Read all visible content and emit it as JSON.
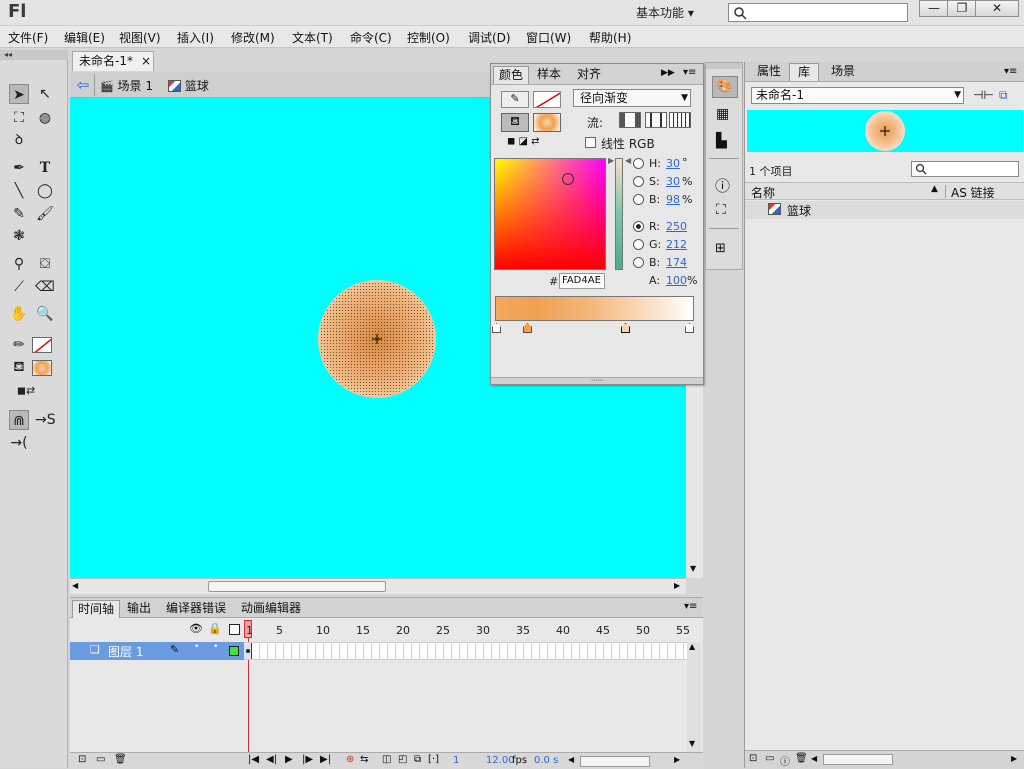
{
  "app": {
    "logo": "Fl",
    "workspace": "基本功能 ▾",
    "window_buttons": [
      "—",
      "❐",
      "✕"
    ]
  },
  "menu": [
    "文件(F)",
    "编辑(E)",
    "视图(V)",
    "插入(I)",
    "修改(M)",
    "文本(T)",
    "命令(C)",
    "控制(O)",
    "调试(D)",
    "窗口(W)",
    "帮助(H)"
  ],
  "document": {
    "tab_title": "未命名-1*",
    "tab_close": "×"
  },
  "editbar": {
    "scene": "场景 1",
    "symbol": "篮球"
  },
  "stage": {
    "background_color": "#00ffff"
  },
  "color_panel": {
    "tabs": [
      "颜色",
      "样本",
      "对齐"
    ],
    "fill_type": "径向渐变",
    "flow_label": "流:",
    "linear_rgb_label": "线性 RGB",
    "hsb": [
      {
        "label": "H:",
        "value": "30",
        "unit": "°"
      },
      {
        "label": "S:",
        "value": "30",
        "unit": "%"
      },
      {
        "label": "B:",
        "value": "98",
        "unit": "%"
      }
    ],
    "rgb": [
      {
        "label": "R:",
        "value": "250"
      },
      {
        "label": "G:",
        "value": "212"
      },
      {
        "label": "B:",
        "value": "174"
      }
    ],
    "hex_label": "#",
    "hex": "FAD4AE",
    "alpha_label": "A:",
    "alpha": "100",
    "alpha_unit": "%"
  },
  "properties_panel": {
    "tabs": [
      "属性",
      "库",
      "场景"
    ],
    "library_name": "未命名-1",
    "item_count": "1 个项目",
    "col_name": "名称",
    "col_linkage": "AS 链接",
    "items": [
      {
        "name": "篮球"
      }
    ]
  },
  "timeline": {
    "tabs": [
      "时间轴",
      "输出",
      "编译器错误",
      "动画编辑器"
    ],
    "frame_numbers": [
      "1",
      "5",
      "10",
      "15",
      "20",
      "25",
      "30",
      "35",
      "40",
      "45",
      "50",
      "55"
    ],
    "layers": [
      {
        "name": "图层 1"
      }
    ],
    "current_frame": "1",
    "fps": "12.00",
    "fps_unit": "fps",
    "time": "0.0 s"
  }
}
